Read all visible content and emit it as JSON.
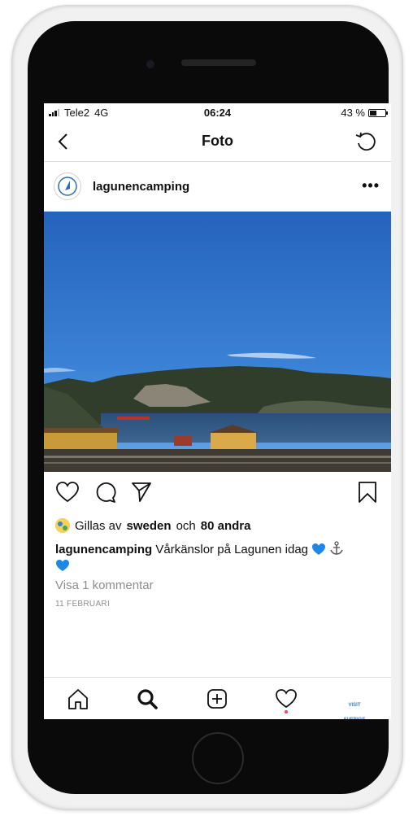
{
  "status_bar": {
    "carrier": "Tele2",
    "network": "4G",
    "time": "06:24",
    "battery": "43 %",
    "battery_level": 0.43
  },
  "nav": {
    "title": "Foto",
    "back_icon": "chevron-left-icon",
    "refresh_icon": "refresh-icon"
  },
  "post": {
    "username": "lagunencamping",
    "more_icon": "more-icon",
    "image_alt": "harbor-landscape-photo",
    "likes": {
      "prefix": "Gillas av",
      "user": "sweden",
      "conjunction": "och",
      "others": "80 andra"
    },
    "caption": {
      "username": "lagunencamping",
      "text": "Vårkänslor på Lagunen idag"
    },
    "comments_link": "Visa 1 kommentar",
    "date": "11 FEBRUARI"
  },
  "tabbar": {
    "items": [
      "home-icon",
      "search-icon",
      "new-post-icon",
      "activity-heart-icon",
      "profile-avatar"
    ],
    "profile_label": "VISIT SVERIGE"
  },
  "colors": {
    "heart_emoji": "#1e88e5",
    "notification_dot": "#ed4956",
    "sky": "#2f72c9"
  }
}
